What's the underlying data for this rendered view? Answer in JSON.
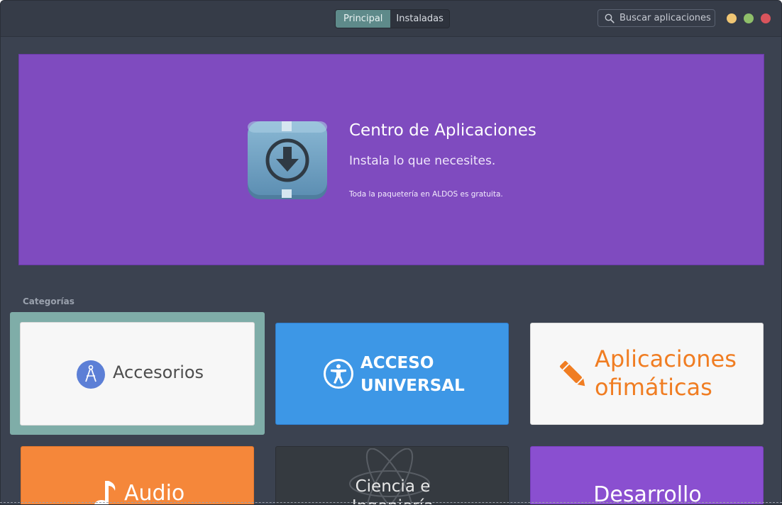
{
  "header": {
    "tabs": [
      {
        "label": "Principal",
        "active": true
      },
      {
        "label": "Instaladas",
        "active": false
      }
    ],
    "search": {
      "placeholder": "Buscar aplicaciones",
      "value": "",
      "icon": "search-icon"
    },
    "window_controls": [
      {
        "name": "minimize",
        "color": "#f0c674"
      },
      {
        "name": "maximize",
        "color": "#8fbf6a"
      },
      {
        "name": "close",
        "color": "#d9545c"
      }
    ]
  },
  "banner": {
    "title": "Centro de Aplicaciones",
    "subtitle": "Instala lo que necesites.",
    "note": "Toda la paquetería en ALDOS es gratuita.",
    "icon": "download-icon",
    "color": "#7f4bbf"
  },
  "categories": {
    "header": "Categorías",
    "items": [
      {
        "label": "Accesorios",
        "icon": "compass-icon",
        "color": "#f7f7f7",
        "focused": true
      },
      {
        "label_line1": "ACCESO",
        "label_line2": "UNIVERSAL",
        "icon": "accessibility-icon",
        "color": "#3d97e6"
      },
      {
        "label_line1": "Aplicaciones",
        "label_line2": "ofimáticas",
        "icon": "pencil-icon",
        "color": "#f7f7f7",
        "text_color": "#f07d22"
      },
      {
        "label": "Audio",
        "icon": "music-note-icon",
        "color": "#f5873a"
      },
      {
        "label_line1": "Ciencia e",
        "label_line2": "Ingeniería",
        "icon": "atom-icon",
        "color": "#353a40"
      },
      {
        "label": "Desarrollo",
        "color": "#8a4fd0"
      }
    ]
  },
  "colors": {
    "window_bg": "#3b4250",
    "active_tab": "#5e8a8a",
    "focus_ring": "#7fada8"
  }
}
